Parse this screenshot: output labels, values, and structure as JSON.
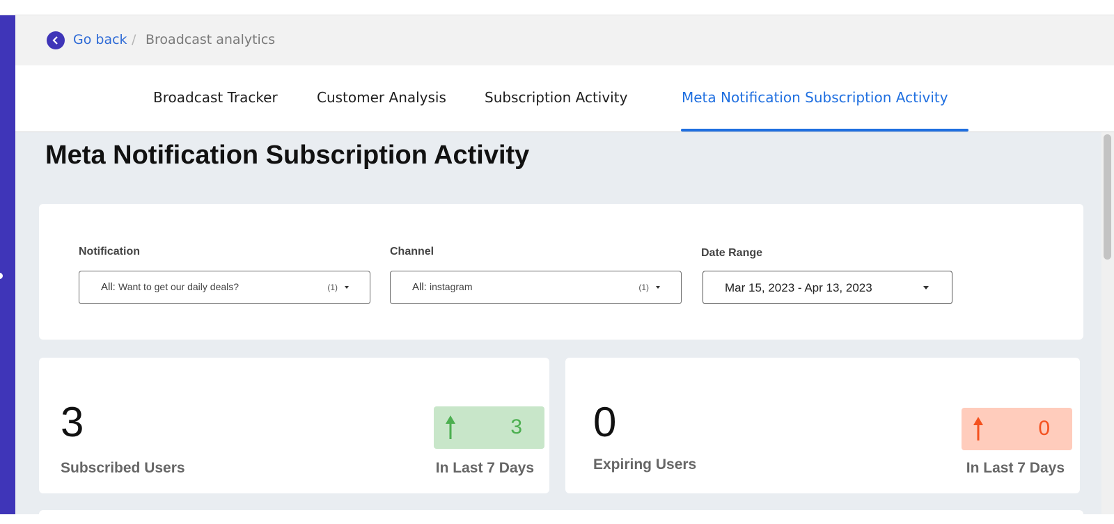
{
  "breadcrumb": {
    "back_label": "Go back",
    "separator": "/",
    "current": "Broadcast analytics"
  },
  "tabs": [
    {
      "label": "Broadcast Tracker",
      "active": false
    },
    {
      "label": "Customer Analysis",
      "active": false
    },
    {
      "label": "Subscription Activity",
      "active": false
    },
    {
      "label": "Meta Notification Subscription Activity",
      "active": true
    }
  ],
  "page": {
    "title": "Meta Notification Subscription Activity"
  },
  "filters": {
    "notification": {
      "label": "Notification",
      "prefix": "All:",
      "value": "Want to get our daily deals?",
      "count": "(1)"
    },
    "channel": {
      "label": "Channel",
      "prefix": "All:",
      "value": "instagram",
      "count": "(1)"
    },
    "date_range": {
      "label": "Date Range",
      "value": "Mar 15, 2023 - Apr 13, 2023"
    }
  },
  "stats": {
    "subscribed": {
      "value": "3",
      "label": "Subscribed Users",
      "trend_value": "3",
      "trend_label": "In Last 7 Days",
      "trend_color": "#4caf50",
      "trend_bg": "#c8e6c9"
    },
    "expiring": {
      "value": "0",
      "label": "Expiring Users",
      "trend_value": "0",
      "trend_label": "In Last 7 Days",
      "trend_color": "#f4511e",
      "trend_bg": "#ffccbc"
    }
  },
  "colors": {
    "accent": "#3f35b8",
    "active_tab": "#1f6fe0",
    "link": "#2f6bd6"
  },
  "icons": {
    "collapse": "double-chevron-left-icon",
    "back": "chevron-left-icon",
    "trend_up": "arrow-up-icon",
    "dropdown": "caret-down-icon"
  }
}
